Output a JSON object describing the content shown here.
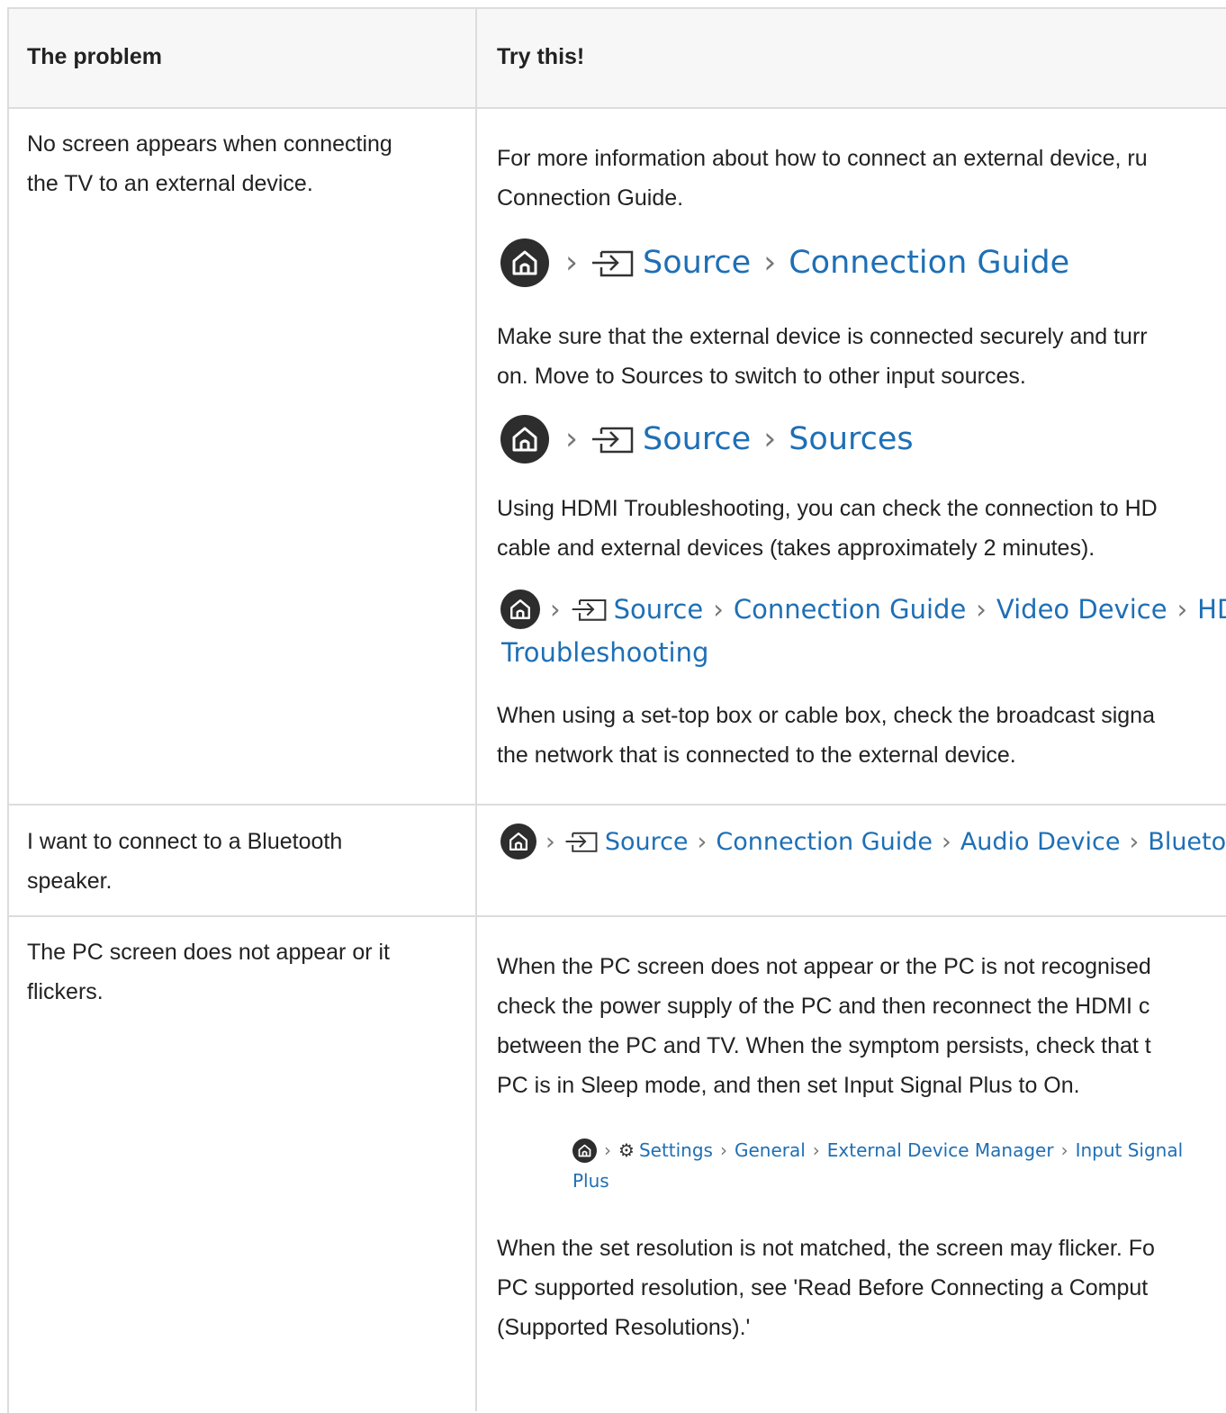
{
  "header": {
    "col_problem": "The problem",
    "col_try": "Try this!"
  },
  "rows": [
    {
      "problem": "No screen appears when connecting\nthe TV to an external device.",
      "p1": "For more information about how to connect an external device, ru\nConnection Guide.",
      "path1": {
        "source": "Source",
        "guide": "Connection Guide"
      },
      "p2": "Make sure that the external device is connected securely and turr\non. Move to Sources to switch to other input sources.",
      "path2": {
        "source": "Source",
        "sources": "Sources"
      },
      "p3": "Using HDMI Troubleshooting, you can check the connection to HD\ncable and external devices (takes approximately 2 minutes).",
      "path3": {
        "source": "Source",
        "guide": "Connection Guide",
        "video": "Video Device",
        "hdmi": "HDI",
        "trouble": "Troubleshooting"
      },
      "p4": "When using a set-top box or cable box, check the broadcast signa\nthe network that is connected to the external device."
    },
    {
      "problem": "I want to connect to a Bluetooth\nspeaker.",
      "path": {
        "source": "Source",
        "guide": "Connection Guide",
        "audio": "Audio Device",
        "bt": "Bluetoo"
      }
    },
    {
      "problem": "The PC screen does not appear or it\nflickers.",
      "p1": "When the PC screen does not appear or the PC is not recognised\ncheck the power supply of the PC and then reconnect the HDMI c\nbetween the PC and TV. When the symptom persists, check that t\nPC is in Sleep mode, and then set Input Signal Plus to On.",
      "path": {
        "settings": "Settings",
        "general": "General",
        "edm": "External Device Manager",
        "isp": "Input Signal",
        "plus": "Plus"
      },
      "p2": "When the set resolution is not matched, the screen may flicker. Fo\nPC supported resolution, see 'Read Before Connecting a Comput\n(Supported Resolutions).'"
    }
  ],
  "colors": {
    "link": "#1e6fb5",
    "border": "#dcdcdc",
    "header_bg": "#f7f7f7"
  },
  "icons": [
    "home-icon",
    "source-icon",
    "chevron-right-icon",
    "gear-icon"
  ]
}
